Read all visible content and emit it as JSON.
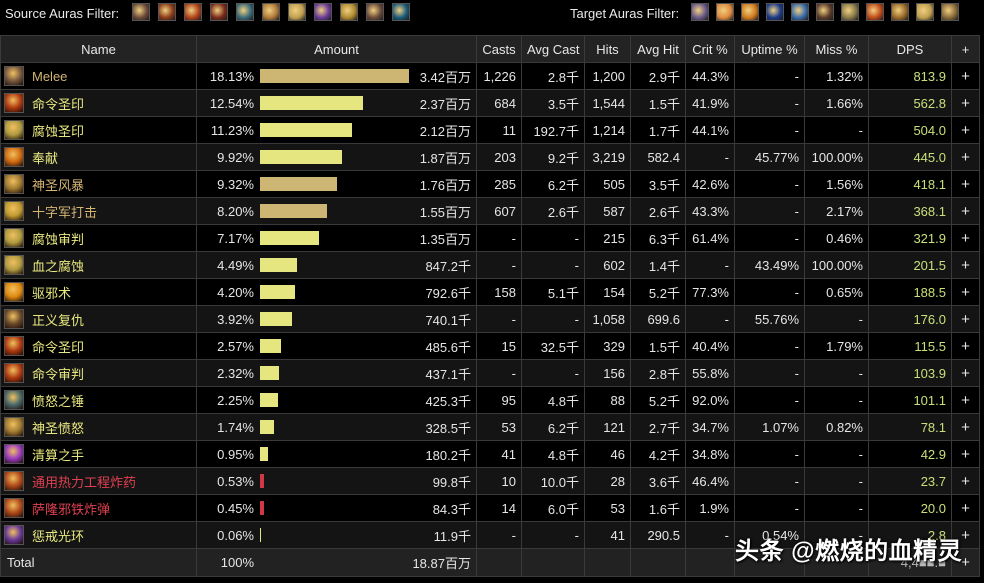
{
  "filters": {
    "source_label": "Source Auras Filter:",
    "source_auras": [
      {
        "icon": "flexed-arm-icon",
        "color": "#6b4a3a"
      },
      {
        "icon": "potion-flame-icon",
        "color": "#8a3a18"
      },
      {
        "icon": "crimson-wings-icon",
        "color": "#b0401a"
      },
      {
        "icon": "blood-rune-icon",
        "color": "#7a2a1a"
      },
      {
        "icon": "frost-armor-icon",
        "color": "#3a6a7a"
      },
      {
        "icon": "golden-hammer-icon",
        "color": "#b07a3a"
      },
      {
        "icon": "golden-fist-icon",
        "color": "#c0a050"
      },
      {
        "icon": "shadow-mushroom-icon",
        "color": "#6a3a9a"
      },
      {
        "icon": "holy-crest-icon",
        "color": "#b08a30"
      },
      {
        "icon": "flexed-arm-icon",
        "color": "#6b4a3a"
      },
      {
        "icon": "frost-claw-icon",
        "color": "#1a5a7a"
      }
    ],
    "target_label": "Target Auras Filter:",
    "target_auras": [
      {
        "icon": "rune-circle-icon",
        "color": "#6a5a8a"
      },
      {
        "icon": "fire-burst-icon",
        "color": "#e08a40"
      },
      {
        "icon": "consecration-icon",
        "color": "#d07a20"
      },
      {
        "icon": "star-burst-icon",
        "color": "#1a3a8a"
      },
      {
        "icon": "frost-strike-icon",
        "color": "#3a6aaa"
      },
      {
        "icon": "dark-beast-icon",
        "color": "#5a3a2a"
      },
      {
        "icon": "crossed-swords-icon",
        "color": "#8a7a4a"
      },
      {
        "icon": "fire-heart-icon",
        "color": "#c04a1a"
      },
      {
        "icon": "golden-skull-icon",
        "color": "#9a6a2a"
      },
      {
        "icon": "holy-crest-icon",
        "color": "#c0a050"
      },
      {
        "icon": "beast-head-icon",
        "color": "#8a6a3a"
      }
    ]
  },
  "table": {
    "headers": {
      "name": "Name",
      "amount": "Amount",
      "casts": "Casts",
      "avg_cast": "Avg Cast",
      "hits": "Hits",
      "avg_hit": "Avg Hit",
      "crit": "Crit %",
      "uptime": "Uptime %",
      "miss": "Miss %",
      "dps": "DPS",
      "add": "+"
    },
    "colors": {
      "name_gold": "#d4b574",
      "name_yellow": "#e8e880",
      "name_red": "#e04050",
      "dps": "#c8e07a",
      "bar_tan": "#cdb574",
      "bar_yellow": "#e6e680",
      "bar_red": "#d03848"
    },
    "rows": [
      {
        "icon": "melee-icon",
        "icon_color": "#7a5a40",
        "name": "Melee",
        "name_color": "#d4b574",
        "pct": "18.13%",
        "bar_fraction": 1.0,
        "bar_color": "#cdb574",
        "amount": "3.42百万",
        "casts": "1,226",
        "avg_cast": "2.8千",
        "hits": "1,200",
        "avg_hit": "2.9千",
        "crit": "44.3%",
        "uptime": "-",
        "miss": "1.32%",
        "dps": "813.9",
        "add": "+"
      },
      {
        "icon": "seal-of-command-icon",
        "icon_color": "#b03a10",
        "name": "命令圣印",
        "name_color": "#e8e880",
        "pct": "12.54%",
        "bar_fraction": 0.692,
        "bar_color": "#e6e680",
        "amount": "2.37百万",
        "casts": "684",
        "avg_cast": "3.5千",
        "hits": "1,544",
        "avg_hit": "1.5千",
        "crit": "41.9%",
        "uptime": "-",
        "miss": "1.66%",
        "dps": "562.8",
        "add": "+"
      },
      {
        "icon": "seal-of-corruption-icon",
        "icon_color": "#b09a40",
        "name": "腐蚀圣印",
        "name_color": "#e8e880",
        "pct": "11.23%",
        "bar_fraction": 0.62,
        "bar_color": "#e6e680",
        "amount": "2.12百万",
        "casts": "11",
        "avg_cast": "192.7千",
        "hits": "1,214",
        "avg_hit": "1.7千",
        "crit": "44.1%",
        "uptime": "-",
        "miss": "-",
        "dps": "504.0",
        "add": "+"
      },
      {
        "icon": "consecration-icon",
        "icon_color": "#d06a10",
        "name": "奉献",
        "name_color": "#e8e880",
        "pct": "9.92%",
        "bar_fraction": 0.547,
        "bar_color": "#e6e680",
        "amount": "1.87百万",
        "casts": "203",
        "avg_cast": "9.2千",
        "hits": "3,219",
        "avg_hit": "582.4",
        "crit": "-",
        "uptime": "45.77%",
        "miss": "100.00%",
        "dps": "445.0",
        "add": "+"
      },
      {
        "icon": "divine-storm-icon",
        "icon_color": "#a07a30",
        "name": "神圣风暴",
        "name_color": "#d4b574",
        "pct": "9.32%",
        "bar_fraction": 0.514,
        "bar_color": "#cdb574",
        "amount": "1.76百万",
        "casts": "285",
        "avg_cast": "6.2千",
        "hits": "505",
        "avg_hit": "3.5千",
        "crit": "42.6%",
        "uptime": "-",
        "miss": "1.56%",
        "dps": "418.1",
        "add": "+"
      },
      {
        "icon": "crusader-strike-icon",
        "icon_color": "#c09a30",
        "name": "十字军打击",
        "name_color": "#d4b574",
        "pct": "8.20%",
        "bar_fraction": 0.452,
        "bar_color": "#cdb574",
        "amount": "1.55百万",
        "casts": "607",
        "avg_cast": "2.6千",
        "hits": "587",
        "avg_hit": "2.6千",
        "crit": "43.3%",
        "uptime": "-",
        "miss": "2.17%",
        "dps": "368.1",
        "add": "+"
      },
      {
        "icon": "judgement-of-corruption-icon",
        "icon_color": "#b09a40",
        "name": "腐蚀审判",
        "name_color": "#e8e880",
        "pct": "7.17%",
        "bar_fraction": 0.395,
        "bar_color": "#e6e680",
        "amount": "1.35百万",
        "casts": "-",
        "avg_cast": "-",
        "hits": "215",
        "avg_hit": "6.3千",
        "crit": "61.4%",
        "uptime": "-",
        "miss": "0.46%",
        "dps": "321.9",
        "add": "+"
      },
      {
        "icon": "blood-corruption-icon",
        "icon_color": "#b09a40",
        "name": "血之腐蚀",
        "name_color": "#e8e880",
        "pct": "4.49%",
        "bar_fraction": 0.248,
        "bar_color": "#e6e680",
        "amount": "847.2千",
        "casts": "-",
        "avg_cast": "-",
        "hits": "602",
        "avg_hit": "1.4千",
        "crit": "-",
        "uptime": "43.49%",
        "miss": "100.00%",
        "dps": "201.5",
        "add": "+"
      },
      {
        "icon": "exorcism-icon",
        "icon_color": "#e08a10",
        "name": "驱邪术",
        "name_color": "#e8e880",
        "pct": "4.20%",
        "bar_fraction": 0.232,
        "bar_color": "#e6e680",
        "amount": "792.6千",
        "casts": "158",
        "avg_cast": "5.1千",
        "hits": "154",
        "avg_hit": "5.2千",
        "crit": "77.3%",
        "uptime": "-",
        "miss": "0.65%",
        "dps": "188.5",
        "add": "+"
      },
      {
        "icon": "righteous-vengeance-icon",
        "icon_color": "#6a4a2a",
        "name": "正义复仇",
        "name_color": "#e8e880",
        "pct": "3.92%",
        "bar_fraction": 0.216,
        "bar_color": "#e6e680",
        "amount": "740.1千",
        "casts": "-",
        "avg_cast": "-",
        "hits": "1,058",
        "avg_hit": "699.6",
        "crit": "-",
        "uptime": "55.76%",
        "miss": "-",
        "dps": "176.0",
        "add": "+"
      },
      {
        "icon": "seal-of-command-icon",
        "icon_color": "#b03a10",
        "name": "命令圣印",
        "name_color": "#e8e880",
        "pct": "2.57%",
        "bar_fraction": 0.142,
        "bar_color": "#e6e680",
        "amount": "485.6千",
        "casts": "15",
        "avg_cast": "32.5千",
        "hits": "329",
        "avg_hit": "1.5千",
        "crit": "40.4%",
        "uptime": "-",
        "miss": "1.79%",
        "dps": "115.5",
        "add": "+"
      },
      {
        "icon": "judgement-of-command-icon",
        "icon_color": "#b03a10",
        "name": "命令审判",
        "name_color": "#e8e880",
        "pct": "2.32%",
        "bar_fraction": 0.128,
        "bar_color": "#e6e680",
        "amount": "437.1千",
        "casts": "-",
        "avg_cast": "-",
        "hits": "156",
        "avg_hit": "2.8千",
        "crit": "55.8%",
        "uptime": "-",
        "miss": "-",
        "dps": "103.9",
        "add": "+"
      },
      {
        "icon": "hammer-of-wrath-icon",
        "icon_color": "#4a6a6a",
        "name": "愤怒之锤",
        "name_color": "#e8e880",
        "pct": "2.25%",
        "bar_fraction": 0.124,
        "bar_color": "#e6e680",
        "amount": "425.3千",
        "casts": "95",
        "avg_cast": "4.8千",
        "hits": "88",
        "avg_hit": "5.2千",
        "crit": "92.0%",
        "uptime": "-",
        "miss": "-",
        "dps": "101.1",
        "add": "+"
      },
      {
        "icon": "holy-wrath-icon",
        "icon_color": "#a07a30",
        "name": "神圣愤怒",
        "name_color": "#e8e880",
        "pct": "1.74%",
        "bar_fraction": 0.096,
        "bar_color": "#e6e680",
        "amount": "328.5千",
        "casts": "53",
        "avg_cast": "6.2千",
        "hits": "121",
        "avg_hit": "2.7千",
        "crit": "34.7%",
        "uptime": "1.07%",
        "miss": "0.82%",
        "dps": "78.1",
        "add": "+"
      },
      {
        "icon": "hand-of-reckoning-icon",
        "icon_color": "#9a3ac0",
        "name": "清算之手",
        "name_color": "#e8e880",
        "pct": "0.95%",
        "bar_fraction": 0.052,
        "bar_color": "#e6e680",
        "amount": "180.2千",
        "casts": "41",
        "avg_cast": "4.8千",
        "hits": "46",
        "avg_hit": "4.2千",
        "crit": "34.8%",
        "uptime": "-",
        "miss": "-",
        "dps": "42.9",
        "add": "+"
      },
      {
        "icon": "thermal-sapper-icon",
        "icon_color": "#b04a1a",
        "name": "通用热力工程炸药",
        "name_color": "#e04050",
        "pct": "0.53%",
        "bar_fraction": 0.029,
        "bar_color": "#d03848",
        "amount": "99.8千",
        "casts": "10",
        "avg_cast": "10.0千",
        "hits": "28",
        "avg_hit": "3.6千",
        "crit": "46.4%",
        "uptime": "-",
        "miss": "-",
        "dps": "23.7",
        "add": "+"
      },
      {
        "icon": "saronite-bomb-icon",
        "icon_color": "#b04a1a",
        "name": "萨隆邪铁炸弹",
        "name_color": "#e04050",
        "pct": "0.45%",
        "bar_fraction": 0.025,
        "bar_color": "#d03848",
        "amount": "84.3千",
        "casts": "14",
        "avg_cast": "6.0千",
        "hits": "53",
        "avg_hit": "1.6千",
        "crit": "1.9%",
        "uptime": "-",
        "miss": "-",
        "dps": "20.0",
        "add": "+"
      },
      {
        "icon": "retribution-aura-icon",
        "icon_color": "#6a3a9a",
        "name": "惩戒光环",
        "name_color": "#e8e880",
        "pct": "0.06%",
        "bar_fraction": 0.004,
        "bar_color": "#e6e680",
        "amount": "11.9千",
        "casts": "-",
        "avg_cast": "-",
        "hits": "41",
        "avg_hit": "290.5",
        "crit": "-",
        "uptime": "0.54%",
        "miss": "-",
        "dps": "2.8",
        "add": "+"
      }
    ],
    "total": {
      "label": "Total",
      "pct": "100%",
      "amount": "18.87百万",
      "dps": "4,4■■.■",
      "add": "+"
    }
  },
  "watermark": "头条 @燃烧的血精灵"
}
